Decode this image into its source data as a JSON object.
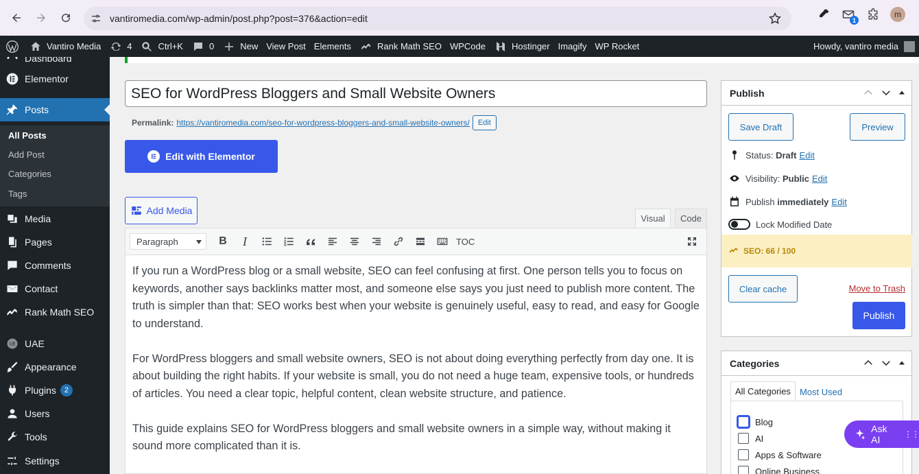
{
  "browser": {
    "url": "vantiromedia.com/wp-admin/post.php?post=376&action=edit",
    "avatar_letter": "m",
    "ext_badge": "1"
  },
  "adminbar": {
    "site": "Vantiro Media",
    "updates": "4",
    "search": "Ctrl+K",
    "comments": "0",
    "new": "New",
    "view_post": "View Post",
    "elements": "Elements",
    "rankmath": "Rank Math SEO",
    "wpcode": "WPCode",
    "hostinger": "Hostinger",
    "imagify": "Imagify",
    "wprocket": "WP Rocket",
    "howdy": "Howdy, vantiro media"
  },
  "sidebar": {
    "dashboard": "Dashboard",
    "elementor": "Elementor",
    "posts": "Posts",
    "sub": [
      "All Posts",
      "Add Post",
      "Categories",
      "Tags"
    ],
    "media": "Media",
    "pages": "Pages",
    "comments": "Comments",
    "contact": "Contact",
    "rankmath": "Rank Math SEO",
    "uae": "UAE",
    "appearance": "Appearance",
    "plugins": "Plugins",
    "plugins_count": "2",
    "users": "Users",
    "tools": "Tools",
    "settings": "Settings"
  },
  "editor": {
    "title": "SEO for WordPress Bloggers and Small Website Owners",
    "permalink_label": "Permalink:",
    "permalink_url": "https://vantiromedia.com/seo-for-wordpress-bloggers-and-small-website-owners/",
    "permalink_edit": "Edit",
    "elementor_btn": "Edit with Elementor",
    "add_media": "Add Media",
    "tab_visual": "Visual",
    "tab_code": "Code",
    "format": "Paragraph",
    "toc": "TOC",
    "paragraphs": [
      "If you run a WordPress blog or a small website, SEO can feel confusing at first. One person tells you to focus on keywords, another says backlinks matter most, and someone else says you just need to publish more content. The truth is simpler than that: SEO works best when your website is genuinely useful, easy to read, and easy for Google to understand.",
      "For WordPress bloggers and small website owners, SEO is not about doing everything perfectly from day one. It is about building the right habits. If your website is small, you do not need a huge team, expensive tools, or hundreds of articles. You need a clear topic, helpful content, clean website structure, and patience.",
      "This guide explains SEO for WordPress bloggers and small website owners in a simple way, without making it sound more complicated than it is."
    ]
  },
  "publish": {
    "title": "Publish",
    "save_draft": "Save Draft",
    "preview": "Preview",
    "status_label": "Status:",
    "status_value": "Draft",
    "visibility_label": "Visibility:",
    "visibility_value": "Public",
    "publish_label": "Publish",
    "publish_value": "immediately",
    "edit": "Edit",
    "lock_modified": "Lock Modified Date",
    "seo_score": "SEO: 66 / 100",
    "clear_cache": "Clear cache",
    "trash": "Move to Trash",
    "publish_btn": "Publish"
  },
  "categories": {
    "title": "Categories",
    "tab_all": "All Categories",
    "tab_used": "Most Used",
    "items": [
      "Blog",
      "AI",
      "Apps & Software",
      "Online Business"
    ]
  },
  "askai": "Ask AI",
  "colors": {
    "wp_blue": "#2271b1",
    "elementor_blue": "#3858e9",
    "admin_dark": "#1d2327",
    "ask_ai_purple": "#7b3ff2"
  }
}
